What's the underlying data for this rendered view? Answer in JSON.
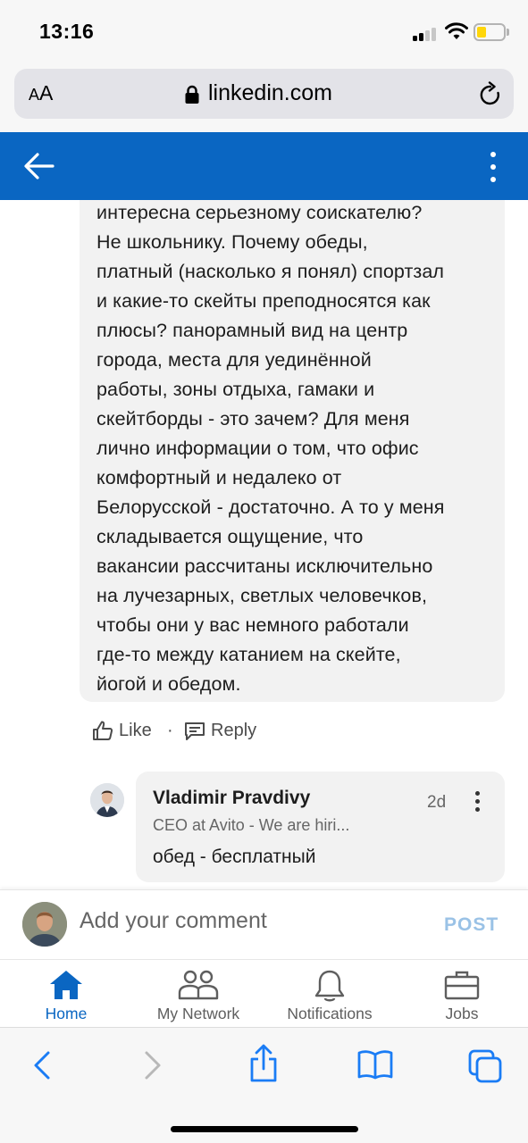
{
  "status_bar": {
    "time": "13:16",
    "battery_level": 0.25,
    "battery_color": "#ffd60a"
  },
  "browser": {
    "text_size_label": "AA",
    "url": "linkedin.com",
    "icons": [
      "lock-icon",
      "reload-icon"
    ]
  },
  "header": {
    "background": "#0a66c2",
    "icons": [
      "back-arrow-icon",
      "more-vertical-icon"
    ]
  },
  "comment": {
    "text_lines": [
      "интересна серьезному соискателю?",
      "Не школьнику. Почему обеды,",
      "платный (насколько я понял) спортзал",
      "и какие-то скейты преподносятся как",
      "плюсы? панорамный вид на центр",
      "города, места для уединённой",
      "работы, зоны отдыха, гамаки и",
      "скейтборды - это зачем? Для меня",
      "лично информации о том, что офис",
      "комфортный и недалеко от",
      "Белорусской - достаточно. А то у меня",
      "складывается ощущение, что",
      "вакансии рассчитаны исключительно",
      "на лучезарных, светлых человечков,",
      "чтобы они у вас немного работали",
      "где-то между катанием на скейте,",
      "йогой и обедом."
    ],
    "actions": {
      "like_label": "Like",
      "separator": "·",
      "reply_label": "Reply"
    }
  },
  "reply": {
    "author": "Vladimir Pravdivy",
    "time": "2d",
    "headline": "CEO at Avito - We are hiri...",
    "text": "обед - бесплатный"
  },
  "composer": {
    "placeholder": "Add your comment",
    "post_label": "POST"
  },
  "bottom_nav": {
    "items": [
      {
        "label": "Home",
        "icon": "home-icon",
        "active": true
      },
      {
        "label": "My Network",
        "icon": "network-icon",
        "active": false
      },
      {
        "label": "Notifications",
        "icon": "bell-icon",
        "active": false
      },
      {
        "label": "Jobs",
        "icon": "briefcase-icon",
        "active": false
      }
    ],
    "active_color": "#0a66c2"
  },
  "safari_toolbar": {
    "icons": [
      "back-icon",
      "forward-icon",
      "share-icon",
      "bookmarks-icon",
      "tabs-icon"
    ],
    "accent": "#1a7cf5"
  }
}
